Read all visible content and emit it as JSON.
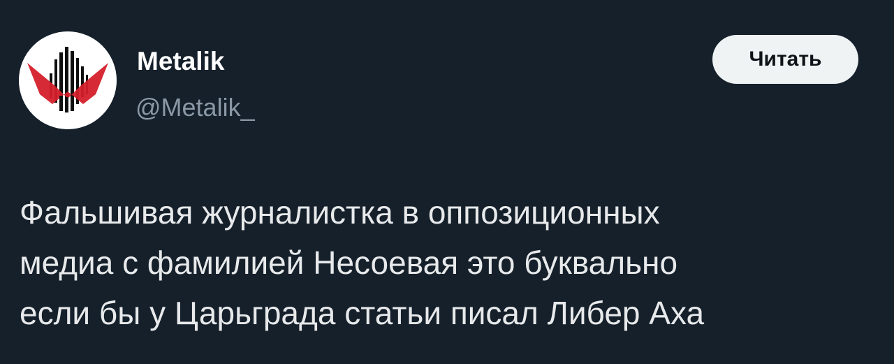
{
  "author": {
    "display_name": "Metalik",
    "handle": "@Metalik_",
    "avatar_icon": "metalik-logo-icon",
    "avatar_colors": {
      "background": "#ffffff",
      "bars": "#0f0f0f",
      "accent": "#d4202b"
    }
  },
  "actions": {
    "follow_label": "Читать"
  },
  "tweet": {
    "lines": [
      "Фальшивая журналистка в оппозиционных",
      "медиа с фамилией Несоевая это буквально",
      "если бы у Царьграда статьи писал Либер Аха"
    ]
  },
  "theme": {
    "background": "#15202b",
    "text": "#e7e9ea",
    "muted": "#8b98a5",
    "button_bg": "#eff3f4"
  }
}
